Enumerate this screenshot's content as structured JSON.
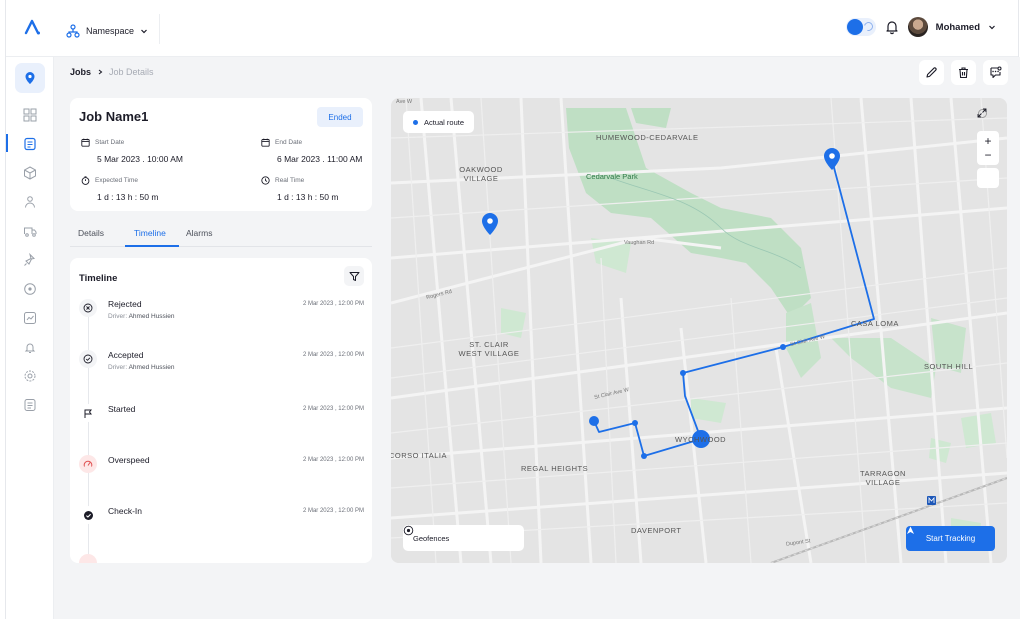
{
  "header": {
    "namespace_label": "Namespace",
    "user_name": "Mohamed"
  },
  "breadcrumb": {
    "root": "Jobs",
    "current": "Job Details"
  },
  "job": {
    "name": "Job Name1",
    "status": "Ended",
    "start_label": "Start Date",
    "start_value": "5 Mar 2023 . 10:00 AM",
    "end_label": "End Date",
    "end_value": "6 Mar 2023 . 11:00 AM",
    "expected_label": "Expected Time",
    "expected_value": "1 d : 13 h : 50 m",
    "real_label": "Real Time",
    "real_value": "1 d : 13 h : 50 m"
  },
  "tabs": [
    {
      "label": "Details"
    },
    {
      "label": "Timeline"
    },
    {
      "label": "Alarms"
    }
  ],
  "timeline": {
    "title": "Timeline",
    "events": [
      {
        "title": "Rejected",
        "driver_prefix": "Driver:",
        "driver": "Ahmed Hussien",
        "time": "2 Mar 2023 , 12:00 PM",
        "icon": "x-circle-icon"
      },
      {
        "title": "Accepted",
        "driver_prefix": "Driver:",
        "driver": "Ahmed Hussien",
        "time": "2 Mar 2023 , 12:00 PM",
        "icon": "check-circle-icon"
      },
      {
        "title": "Started",
        "time": "2 Mar 2023 , 12:00 PM",
        "icon": "flag-icon"
      },
      {
        "title": "Overspeed",
        "time": "2 Mar 2023 , 12:00 PM",
        "icon": "speedometer-icon"
      },
      {
        "title": "Check-In",
        "time": "2 Mar 2023 , 12:00 PM",
        "icon": "check-filled-icon"
      }
    ]
  },
  "map": {
    "legend": "Actual route",
    "geofences": "Geofences",
    "start_tracking": "Start Tracking",
    "labels": {
      "humewood": "HUMEWOOD-CEDARVALE",
      "oakwood": "OAKWOOD\nVILLAGE",
      "cedarvale": "Cedarvale Park",
      "stclair": "ST. CLAIR\nWEST VILLAGE",
      "casaloma": "CASA LOMA",
      "southhill": "SOUTH HILL",
      "wychwood": "WYCHWOOD",
      "corso": "CORSO ITALIA",
      "regal": "REGAL HEIGHTS",
      "tarragon": "TARRAGON\nVILLAGE",
      "davenport": "DAVENPORT",
      "vaughan": "Vaughan Rd",
      "rogers": "Rogers Rd",
      "stclairave": "St Clair Ave W",
      "stclairave2": "St Clair Ave W",
      "dupont": "Dupont St",
      "ave": "Ave W"
    },
    "route_color": "#1d6fe8"
  },
  "colors": {
    "accent": "#1d6fe8",
    "map_bg": "#e4e4e4",
    "park": "#b9dcbf"
  }
}
